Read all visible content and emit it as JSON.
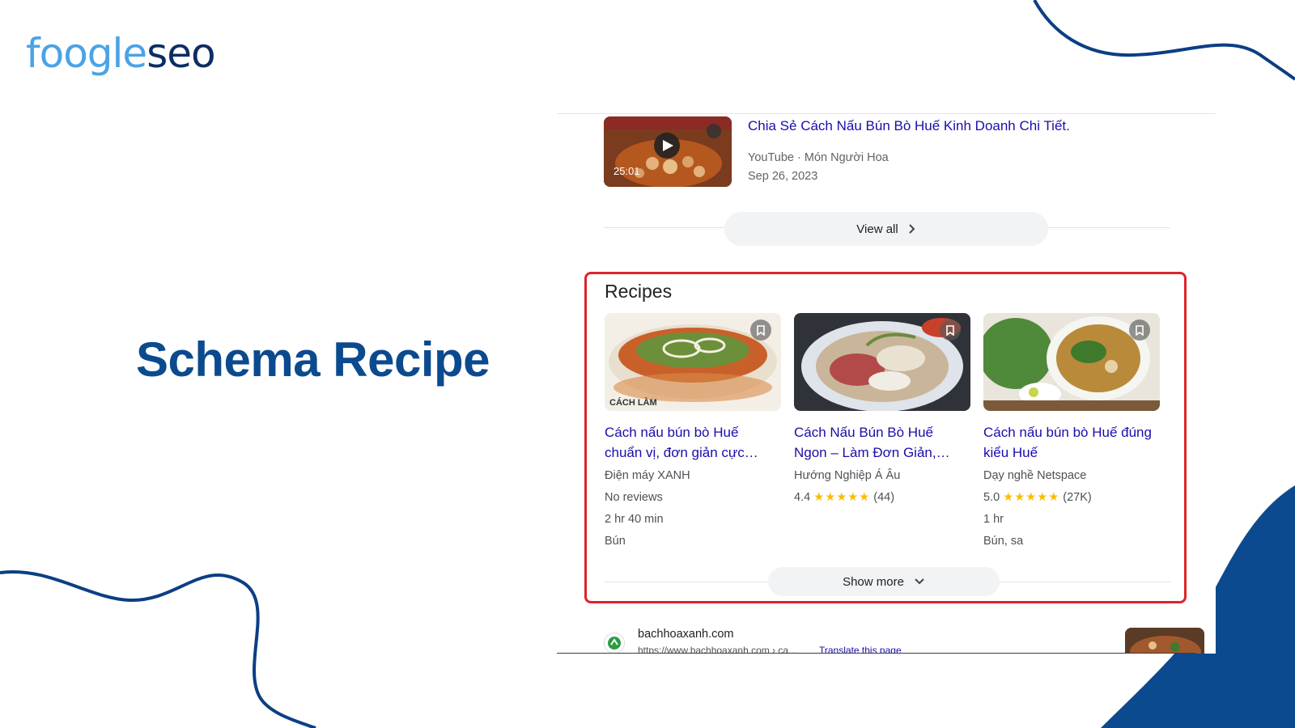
{
  "logo": {
    "part1": "foogle",
    "part2": "seo"
  },
  "slide": {
    "title": "Schema Recipe"
  },
  "video": {
    "title": "Chia Sẻ Cách Nấu Bún Bò Huế Kinh Doanh Chi Tiết.",
    "meta": "YouTube · Món Người Hoa",
    "date": "Sep 26, 2023",
    "duration": "25:01"
  },
  "view_all": {
    "label": "View all",
    "icon": "chevron-right-icon"
  },
  "recipes": {
    "heading": "Recipes",
    "cards": [
      {
        "title_line1": "Cách nấu bún bò Huế",
        "title_line2": "chuẩn vị, đơn giản cực…",
        "source": "Điện máy XANH",
        "rating": "No reviews",
        "time": "2 hr 40 min",
        "ingredients": "Bún",
        "image_label": "CÁCH LÀM"
      },
      {
        "title_line1": "Cách Nấu Bún Bò Huế",
        "title_line2": "Ngon – Làm Đơn Giản,…",
        "source": "Hướng Nghiệp Á Âu",
        "rating_value": "4.4",
        "stars": "★★★★★",
        "rating_count": "(44)"
      },
      {
        "title_line1": "Cách nấu bún bò Huế đúng",
        "title_line2": "kiểu Huế",
        "source": "Dạy nghề Netspace",
        "rating_value": "5.0",
        "stars": "★★★★★",
        "rating_count": "(27K)",
        "time": "1 hr",
        "ingredients": "Bún, sa"
      }
    ]
  },
  "show_more": {
    "label": "Show more",
    "icon": "chevron-down-icon"
  },
  "result": {
    "site": "bachhoaxanh.com",
    "url": "https://www.bachhoaxanh.com › ca...",
    "translate": "Translate this page"
  },
  "colors": {
    "brand_blue": "#0b4a8e",
    "link": "#1a0dab",
    "highlight_red": "#d9262b",
    "star": "#fbbc04"
  }
}
